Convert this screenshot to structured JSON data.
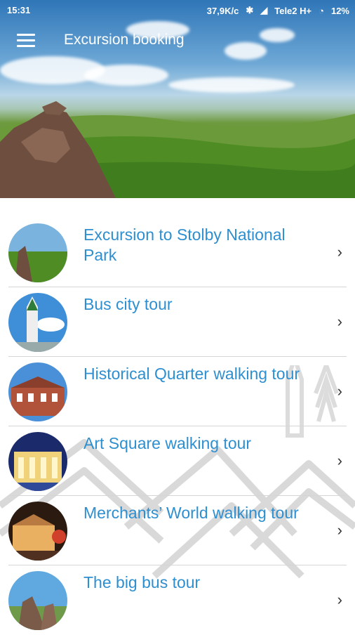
{
  "status_bar": {
    "time": "15:31",
    "speed": "37,9K/c",
    "carrier": "Tele2 H+",
    "battery": "12%"
  },
  "app_bar": {
    "title": "Excursion booking",
    "menu_icon": "hamburger-menu-icon"
  },
  "tours": [
    {
      "label": "Excursion to Stolby National Park"
    },
    {
      "label": "Bus city tour"
    },
    {
      "label": "Historical Quarter walking tour"
    },
    {
      "label": "Art Square walking tour"
    },
    {
      "label": "Merchants’ World walking tour"
    },
    {
      "label": "The big bus tour"
    }
  ],
  "colors": {
    "accent": "#2e8fd0",
    "divider": "#d5d5d5"
  }
}
